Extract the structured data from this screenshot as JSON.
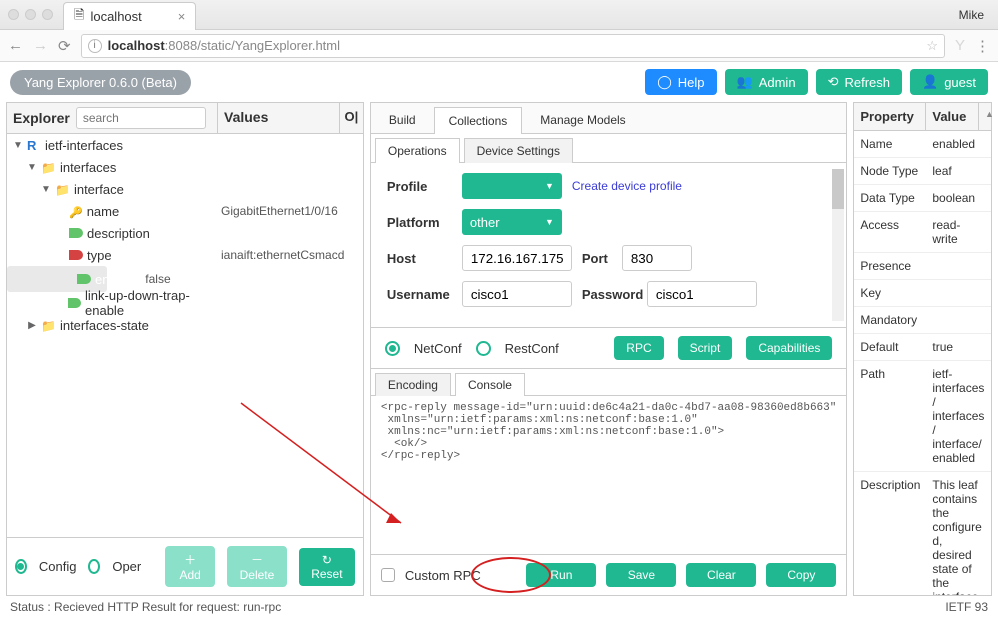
{
  "browser": {
    "tab_title": "localhost",
    "user": "Mike",
    "url_host": "localhost",
    "url_rest": ":8088/static/YangExplorer.html"
  },
  "app": {
    "version_badge": "Yang Explorer 0.6.0 (Beta)",
    "help": "Help",
    "admin": "Admin",
    "refresh": "Refresh",
    "guest": "guest"
  },
  "explorer": {
    "title": "Explorer",
    "search_placeholder": "search",
    "col_values": "Values",
    "col_op": "O|",
    "rows": [
      {
        "label": "ietf-interfaces",
        "value": ""
      },
      {
        "label": "interfaces",
        "value": ""
      },
      {
        "label": "interface",
        "value": ""
      },
      {
        "label": "name",
        "value": "GigabitEthernet1/0/16"
      },
      {
        "label": "description",
        "value": ""
      },
      {
        "label": "type",
        "value": "ianaift:ethernetCsmacd"
      },
      {
        "label": "enabled",
        "value": "false"
      },
      {
        "label": "link-up-down-trap-enable",
        "value": ""
      },
      {
        "label": "interfaces-state",
        "value": ""
      }
    ],
    "config": "Config",
    "oper": "Oper",
    "add": "Add",
    "delete": "Delete",
    "reset": "Reset"
  },
  "center": {
    "tabs": {
      "build": "Build",
      "collections": "Collections",
      "manage": "Manage Models"
    },
    "subtabs": {
      "operations": "Operations",
      "device": "Device Settings"
    },
    "profile_label": "Profile",
    "profile_value": "",
    "create_profile": "Create device profile",
    "platform_label": "Platform",
    "platform_value": "other",
    "host_label": "Host",
    "host_value": "172.16.167.175",
    "port_label": "Port",
    "port_value": "830",
    "user_label": "Username",
    "user_value": "cisco1",
    "pass_label": "Password",
    "pass_value": "cisco1",
    "netconf": "NetConf",
    "restconf": "RestConf",
    "rpc": "RPC",
    "script": "Script",
    "caps": "Capabilities",
    "encoding": "Encoding",
    "console": "Console",
    "console_text": "<rpc-reply message-id=\"urn:uuid:de6c4a21-da0c-4bd7-aa08-98360ed8b663\"\n xmlns=\"urn:ietf:params:xml:ns:netconf:base:1.0\"\n xmlns:nc=\"urn:ietf:params:xml:ns:netconf:base:1.0\">\n  <ok/>\n</rpc-reply>",
    "custom_rpc": "Custom RPC",
    "run": "Run",
    "save": "Save",
    "clear": "Clear",
    "copy": "Copy"
  },
  "props": {
    "header_prop": "Property",
    "header_val": "Value",
    "rows": [
      {
        "p": "Name",
        "v": "enabled"
      },
      {
        "p": "Node Type",
        "v": "leaf"
      },
      {
        "p": "Data Type",
        "v": "boolean"
      },
      {
        "p": "Access",
        "v": "read-write"
      },
      {
        "p": "Presence",
        "v": ""
      },
      {
        "p": "Key",
        "v": ""
      },
      {
        "p": "Mandatory",
        "v": ""
      },
      {
        "p": "Default",
        "v": "true"
      },
      {
        "p": "Path",
        "v": "ietf-interfaces/ interfaces/ interface/ enabled"
      },
      {
        "p": "Description",
        "v": "This leaf contains the configured, desired state of the interface."
      }
    ]
  },
  "status": {
    "msg": "Status : Recieved HTTP Result for request: run-rpc",
    "right": "IETF 93"
  }
}
